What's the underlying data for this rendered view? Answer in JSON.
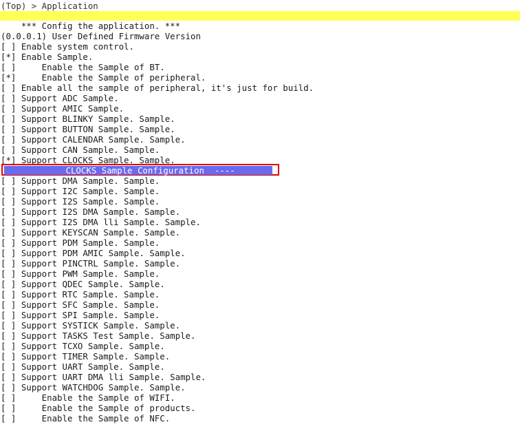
{
  "path": "(Top) > Application",
  "menu": {
    "items": [
      "    *** Config the application. ***",
      "(0.0.0.1) User Defined Firmware Version",
      "[ ] Enable system control.",
      "[*] Enable Sample.",
      "[ ]     Enable the Sample of BT.",
      "[*]     Enable the Sample of peripheral.",
      "[ ] Enable all the sample of peripheral, it's just for build.",
      "[ ] Support ADC Sample.",
      "[ ] Support AMIC Sample.",
      "[ ] Support BLINKY Sample. Sample.",
      "[ ] Support BUTTON Sample. Sample.",
      "[ ] Support CALENDAR Sample. Sample.",
      "[ ] Support CAN Sample. Sample.",
      "[*] Support CLOCKS Sample. Sample.",
      "",
      "[ ] Support DMA Sample. Sample.",
      "[ ] Support I2C Sample. Sample.",
      "[ ] Support I2S Sample. Sample.",
      "[ ] Support I2S DMA Sample. Sample.",
      "[ ] Support I2S DMA lli Sample. Sample.",
      "[ ] Support KEYSCAN Sample. Sample.",
      "[ ] Support PDM Sample. Sample.",
      "[ ] Support PDM AMIC Sample. Sample.",
      "[ ] Support PINCTRL Sample. Sample.",
      "[ ] Support PWM Sample. Sample.",
      "[ ] Support QDEC Sample. Sample.",
      "[ ] Support RTC Sample. Sample.",
      "[ ] Support SFC Sample. Sample.",
      "[ ] Support SPI Sample. Sample.",
      "[ ] Support SYSTICK Sample. Sample.",
      "[ ] Support TASKS Test Sample. Sample.",
      "[ ] Support TCXO Sample. Sample.",
      "[ ] Support TIMER Sample. Sample.",
      "[ ] Support UART Sample. Sample.",
      "[ ] Support UART DMA lli Sample. Sample.",
      "[ ] Support WATCHDOG Sample. Sample.",
      "[ ]     Enable the Sample of WIFI.",
      "[ ]     Enable the Sample of products.",
      "[ ]     Enable the Sample of NFC."
    ],
    "selected": "            CLOCKS Sample Configuration  ----"
  },
  "colors": {
    "highlight": "#ffff55",
    "selection_bg": "#6a6aee",
    "selection_border": "#e00000"
  }
}
